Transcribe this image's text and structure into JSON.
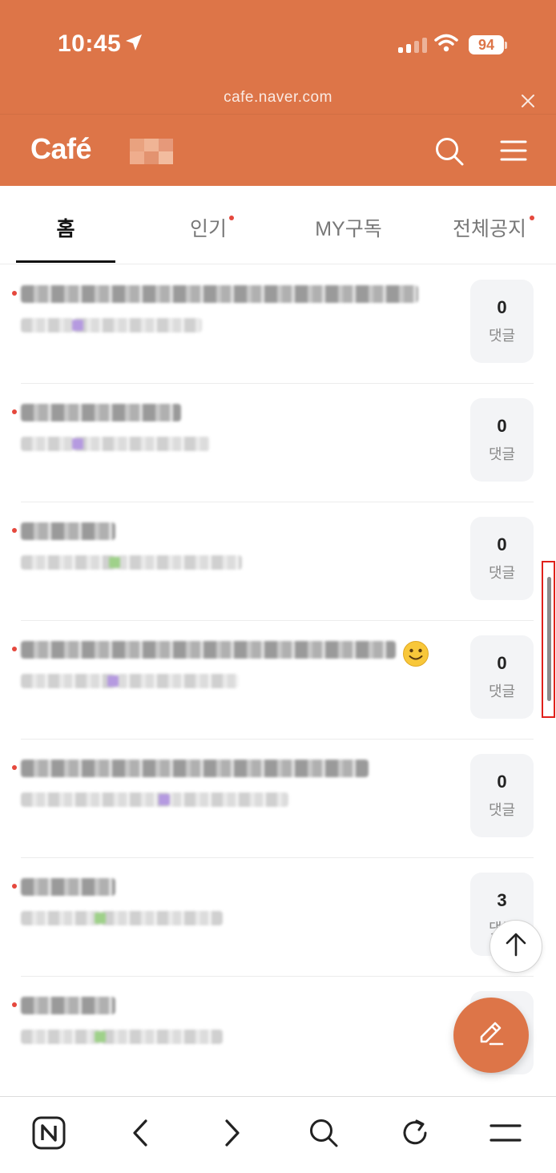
{
  "status_bar": {
    "time": "10:45",
    "battery": "94"
  },
  "browser": {
    "url": "cafe.naver.com"
  },
  "header": {
    "logo": "Café",
    "cafe_name_blurred": true
  },
  "tabs": [
    {
      "label": "홈",
      "active": true,
      "has_dot": false
    },
    {
      "label": "인기",
      "active": false,
      "has_dot": true
    },
    {
      "label": "MY구독",
      "active": false,
      "has_dot": false
    },
    {
      "label": "전체공지",
      "active": false,
      "has_dot": true
    }
  ],
  "posts": [
    {
      "comments": "0",
      "comment_label": "댓글",
      "emoji": ""
    },
    {
      "comments": "0",
      "comment_label": "댓글",
      "emoji": ""
    },
    {
      "comments": "0",
      "comment_label": "댓글",
      "emoji": ""
    },
    {
      "comments": "0",
      "comment_label": "댓글",
      "emoji": "🙂"
    },
    {
      "comments": "0",
      "comment_label": "댓글",
      "emoji": ""
    },
    {
      "comments": "3",
      "comment_label": "댓글",
      "emoji": ""
    },
    {
      "comments": "",
      "comment_label": "",
      "emoji": ""
    }
  ],
  "icons": {
    "location": "location-arrow-icon",
    "signal": "signal-icon",
    "wifi": "wifi-icon",
    "close": "close-icon",
    "search": "search-icon",
    "menu": "hamburger-menu-icon",
    "scroll_top": "arrow-up-icon",
    "write": "pencil-icon",
    "naver_home": "naver-n-icon",
    "back": "chevron-left-icon",
    "forward": "chevron-right-icon",
    "refresh": "refresh-icon"
  },
  "colors": {
    "brand": "#dd7548",
    "new_dot": "#e5483d"
  }
}
